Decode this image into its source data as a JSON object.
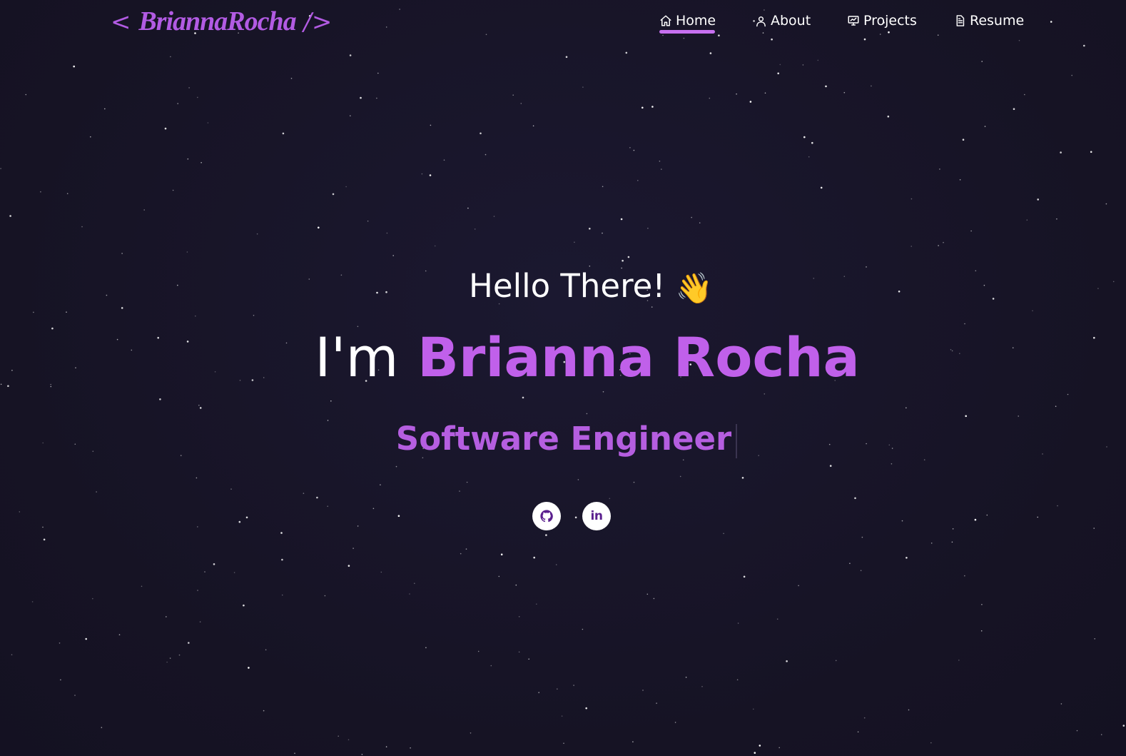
{
  "brand": {
    "logo_open": "<",
    "logo_name": "BriannaRocha",
    "logo_close": "/>"
  },
  "nav": {
    "items": [
      {
        "label": "Home",
        "icon": "home-icon",
        "active": true
      },
      {
        "label": "About",
        "icon": "user-icon",
        "active": false
      },
      {
        "label": "Projects",
        "icon": "presentation-icon",
        "active": false
      },
      {
        "label": "Resume",
        "icon": "document-icon",
        "active": false
      }
    ]
  },
  "hero": {
    "greeting": "Hello There!",
    "greeting_emoji": "👋",
    "intro_prefix": "I'm",
    "name": "Brianna Rocha",
    "role": "Software Engineer"
  },
  "social": {
    "github_icon": "github-icon",
    "linkedin_label": "in"
  },
  "colors": {
    "background": "#171426",
    "accent": "#c060ea",
    "role": "#b55ee0",
    "text": "#ffffff"
  }
}
